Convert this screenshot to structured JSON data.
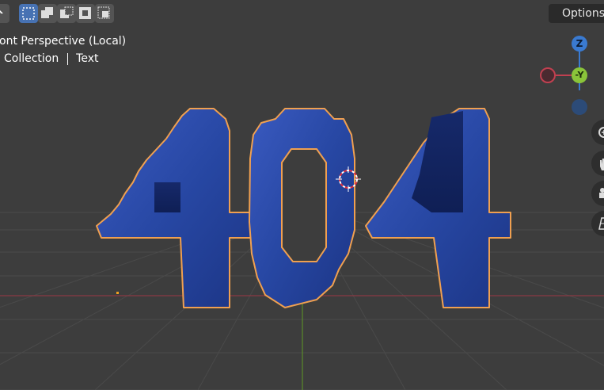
{
  "viewport": {
    "view_label": "ont Perspective (Local)",
    "collection_label": "Collection",
    "object_label": "Text",
    "options_label": "Options",
    "scene_text": "404"
  },
  "toolbar": {
    "selection_modes": [
      "select-new-icon",
      "select-extend-icon",
      "select-subtract-icon",
      "select-invert-icon",
      "select-intersect-icon"
    ]
  },
  "gizmo": {
    "z_label": "Z",
    "y_label": "-Y"
  },
  "colors": {
    "background": "#3d3d3d",
    "object_fill": "#2b4aa8",
    "selection_outline": "#f0a050",
    "x_axis": "#c04050",
    "y_axis": "#8ac43a",
    "z_axis": "#3a7ad0"
  }
}
